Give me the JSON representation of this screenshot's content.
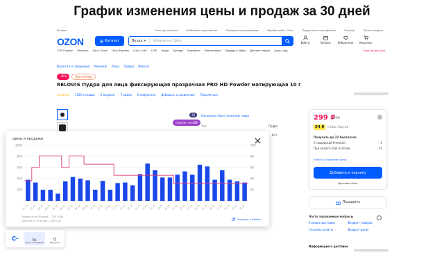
{
  "banner": {
    "title": "График изменения цены и продаж за 30 дней"
  },
  "topbar": {
    "location": "Москва",
    "links": [
      "Ozon для бизнеса",
      "Мобильное приложение",
      "Реферальная программа",
      "Зарабатывай с Ozon",
      "Подарочные сертификаты",
      "Помощь",
      "Пункты выдачи"
    ]
  },
  "header": {
    "logo": "OZON",
    "catalog_label": "Каталог",
    "search_category": "Везде",
    "search_placeholder": "Искать на Ozon",
    "icons": [
      {
        "label": "Войти",
        "icon": "user-icon"
      },
      {
        "label": "Заказы",
        "icon": "box-icon"
      },
      {
        "label": "Избранное",
        "icon": "heart-icon"
      },
      {
        "label": "Корзина",
        "icon": "cart-icon"
      }
    ]
  },
  "nav": {
    "items": [
      "TOP Fashion",
      "Premium",
      "Ozon Travel",
      "Ozon Express",
      "Ozon Счёт",
      "LIVE",
      "Акции",
      "Бренды",
      "Магазины",
      "Электроника",
      "Одежда и обувь",
      "Детские товары",
      "Дом и сад"
    ],
    "last": "Зона лучших цен"
  },
  "breadcrumbs": [
    "Красота и здоровье",
    "Макияж",
    "Лицо",
    "Пудра",
    "Relouis"
  ],
  "product": {
    "discount_badge": "-46%",
    "badge2": "Бестселлер",
    "title": "RELOUIS Пудра для лица фиксирующая прозрачная PRO HD Powder матирующая 10 г",
    "rating_stars": "★★★★★",
    "reviews": "1150 отзывов",
    "questions": "2 вопроса",
    "video": "7 видео",
    "fav": "В избранное",
    "compare": "Добавить к сравнению",
    "share": "Поделиться"
  },
  "gallery": {
    "badge": "18",
    "pill": "Снижен на 46₽"
  },
  "specs": {
    "link": "Насколько Ozon полезный товар",
    "rows": [
      {
        "k": "Тип",
        "v": "Пудра"
      },
      {
        "k": "",
        "v": ""
      },
      {
        "k": "",
        "v": "10 г"
      }
    ]
  },
  "buy": {
    "price": "299 ₽",
    "old_price": "554₽",
    "ozon_price": "54 ₽",
    "ozon_label": "с Ozon Картой",
    "delivery_title": "Получить до 22 бесплатно",
    "delivery_rows": [
      {
        "k": "С подпиской Premium",
        "v": "0"
      },
      {
        "k": "При оплате Ozon Счётом",
        "v": "10"
      }
    ],
    "notice": "Узнать о снижении цены",
    "add_to_cart": "Добавить в корзину",
    "shipping": "Доставка Ozon"
  },
  "subscribe_label": "Подарить",
  "faq": {
    "title": "Часто задаваемые вопросы",
    "items": [
      "Условия доставки",
      "Возврат товаров",
      "Способы оплаты",
      "Возврат денег"
    ]
  },
  "info_title": "Информация о доставке",
  "panel": {
    "title": "Цены и продажи",
    "footnote1": "Продажи за 30 дней — 215 450р",
    "footnote2": "Прогноз за 30 дней — 2813 шт",
    "open_link": "Открыть в Sheets"
  },
  "extension": {
    "tab1": "Цены и продажи",
    "tab2": "Выручка"
  },
  "chart_data": {
    "type": "bar",
    "title": "Цены и продажи",
    "categories": [
      "01.10",
      "02.10",
      "03.10",
      "04.10",
      "05.10",
      "06.10",
      "07.10",
      "08.10",
      "09.10",
      "10.10",
      "11.10",
      "12.10",
      "13.10",
      "14.10",
      "15.10",
      "16.10",
      "17.10",
      "18.10",
      "19.10",
      "20.10",
      "21.10",
      "22.10",
      "23.10",
      "24.10",
      "25.10",
      "26.10",
      "27.10",
      "28.10",
      "29.10",
      "30.10"
    ],
    "yleft_ticks": [
      "1000",
      "800",
      "600",
      "400",
      "200"
    ],
    "yright_ticks": [
      "100",
      "80",
      "60",
      "40",
      "20"
    ],
    "ylim_left": [
      0,
      1000
    ],
    "ylim_right": [
      0,
      100
    ],
    "series": [
      {
        "kind": "bar",
        "axis": "right",
        "color": "#1a47e8",
        "values": [
          38,
          33,
          20,
          20,
          13,
          35,
          43,
          40,
          37,
          20,
          36,
          20,
          32,
          33,
          28,
          48,
          67,
          55,
          42,
          42,
          47,
          53,
          47,
          65,
          62,
          38,
          55,
          38,
          35,
          33
        ]
      },
      {
        "kind": "line",
        "axis": "left",
        "color": "#e03a7a",
        "values": [
          360,
          600,
          810,
          810,
          810,
          600,
          810,
          810,
          660,
          660,
          660,
          660,
          460,
          460,
          460,
          460,
          460,
          460,
          460,
          460,
          310,
          310,
          310,
          310,
          310,
          310,
          310,
          310,
          310,
          310
        ]
      }
    ]
  }
}
